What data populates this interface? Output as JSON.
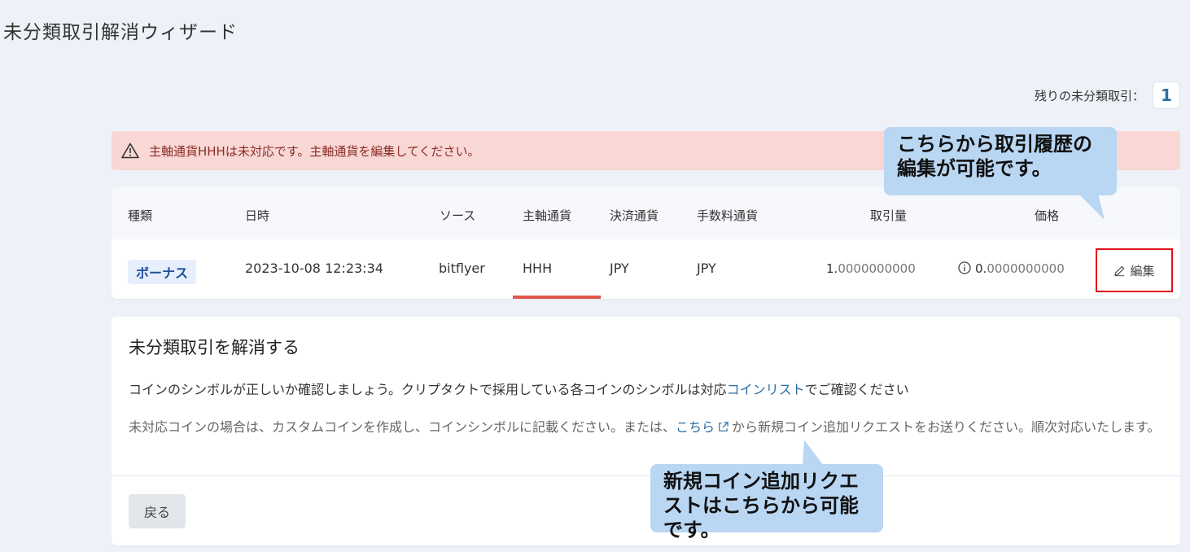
{
  "page_title": "未分類取引解消ウィザード",
  "remaining": {
    "label": "残りの未分類取引：",
    "count": "1"
  },
  "alert": {
    "message": "主軸通貨HHHは未対応です。主軸通貨を編集してください。",
    "icon": "warning-triangle-icon"
  },
  "table": {
    "headers": [
      "種類",
      "日時",
      "ソース",
      "主軸通貨",
      "決済通貨",
      "手数料通貨",
      "取引量",
      "価格"
    ],
    "row": {
      "type": "ボーナス",
      "datetime": "2023-10-08 12:23:34",
      "source": "bitflyer",
      "base_currency": "HHH",
      "settlement_currency": "JPY",
      "fee_currency": "JPY",
      "amount_main": "1.",
      "amount_frac": "0000000000",
      "price_main": "0.",
      "price_frac": "0000000000",
      "edit_label": "編集"
    }
  },
  "resolve": {
    "title": "未分類取引を解消する",
    "p1_before": "コインのシンボルが正しいか確認しましょう。クリプタクトで採用している各コインのシンボルは対応",
    "p1_link": "コインリスト",
    "p1_after": "でご確認ください",
    "p2_before": "未対応コインの場合は、カスタムコインを作成し、コインシンボルに記載ください。または、",
    "p2_link": "こちら",
    "p2_after": "から新規コイン追加リクエストをお送りください。順次対応いたします。",
    "back_label": "戻る"
  },
  "callouts": {
    "edit": "こちらから取引履歴の編集が可能です。",
    "coin": "新規コイン追加リクエストはこちらから可能です。"
  },
  "colors": {
    "alert_bg": "#f8d7d5",
    "link": "#2b6ea3",
    "highlight_border": "#e3101c",
    "callout_bg": "#b9d6f3"
  }
}
